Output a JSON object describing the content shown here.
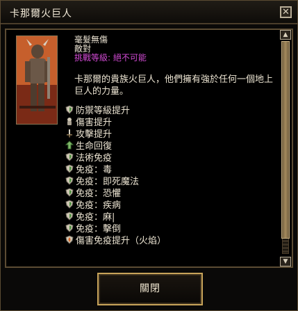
{
  "window": {
    "title": "卡那爾火巨人",
    "close_icon": "x-icon"
  },
  "creature": {
    "attitude": "毫髮無傷",
    "relation": "敵對",
    "challenge": "挑戰等級: 絕不可能",
    "description": "卡那爾的貴族火巨人，他們擁有強於任何一個地上巨人的力量。",
    "portrait": "fire-giant-portrait"
  },
  "abilities": [
    {
      "label": "防禦等級提升",
      "icon": "shield-icon"
    },
    {
      "label": "傷害提升",
      "icon": "fist-icon"
    },
    {
      "label": "攻擊提升",
      "icon": "sword-icon"
    },
    {
      "label": "生命回復",
      "icon": "heal-icon"
    },
    {
      "label": "法術免疫",
      "icon": "shield-icon"
    },
    {
      "label": "免疫：毒",
      "icon": "shield-icon"
    },
    {
      "label": "免疫：即死魔法",
      "icon": "shield-icon"
    },
    {
      "label": "免疫：恐懼",
      "icon": "shield-icon"
    },
    {
      "label": "免疫：疾病",
      "icon": "shield-icon"
    },
    {
      "label": "免疫：麻|",
      "icon": "shield-icon"
    },
    {
      "label": "免疫：擊倒",
      "icon": "shield-icon"
    },
    {
      "label": "傷害免疫提升（火焰）",
      "icon": "flame-shield-icon"
    }
  ],
  "footer": {
    "close_label": "關閉"
  },
  "colors": {
    "challenge_text": "#d14ad3",
    "frame_gold": "#c8a45a"
  }
}
